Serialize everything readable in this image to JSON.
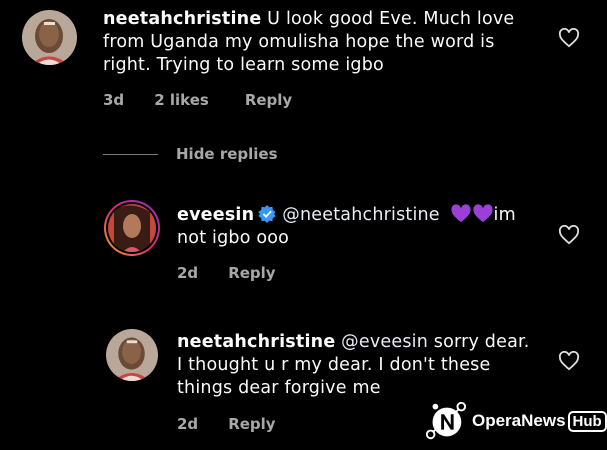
{
  "comments": [
    {
      "username": "neetahchristine",
      "text_line1": "U look good Eve. Much love",
      "text_line2": "from Uganda my omulisha hope the word is",
      "text_line3": "right. Trying to learn some igbo",
      "time": "3d",
      "likes": "2 likes",
      "reply_label": "Reply"
    }
  ],
  "hide_replies_label": "Hide replies",
  "replies": [
    {
      "username": "eveesin",
      "mention": "@neetahchristine",
      "text_after_emoji": "im",
      "text_line2": "not igbo ooo",
      "time": "2d",
      "reply_label": "Reply",
      "emojis": [
        "purple-heart",
        "purple-heart"
      ]
    },
    {
      "username": "neetahchristine",
      "mention": "@eveesin",
      "text_line1_rest": "sorry dear.",
      "text_line2": "I thought u r my dear. I don't these",
      "text_line3": "things dear forgive me",
      "time": "2d",
      "reply_label": "Reply"
    }
  ],
  "watermark": {
    "brand": "OperaNews",
    "hub": "Hub"
  },
  "colors": {
    "background": "#000000",
    "text": "#fafafa",
    "meta": "#a8a8a8",
    "verified": "#3897f0",
    "purple_heart": "#9b3fd6"
  }
}
